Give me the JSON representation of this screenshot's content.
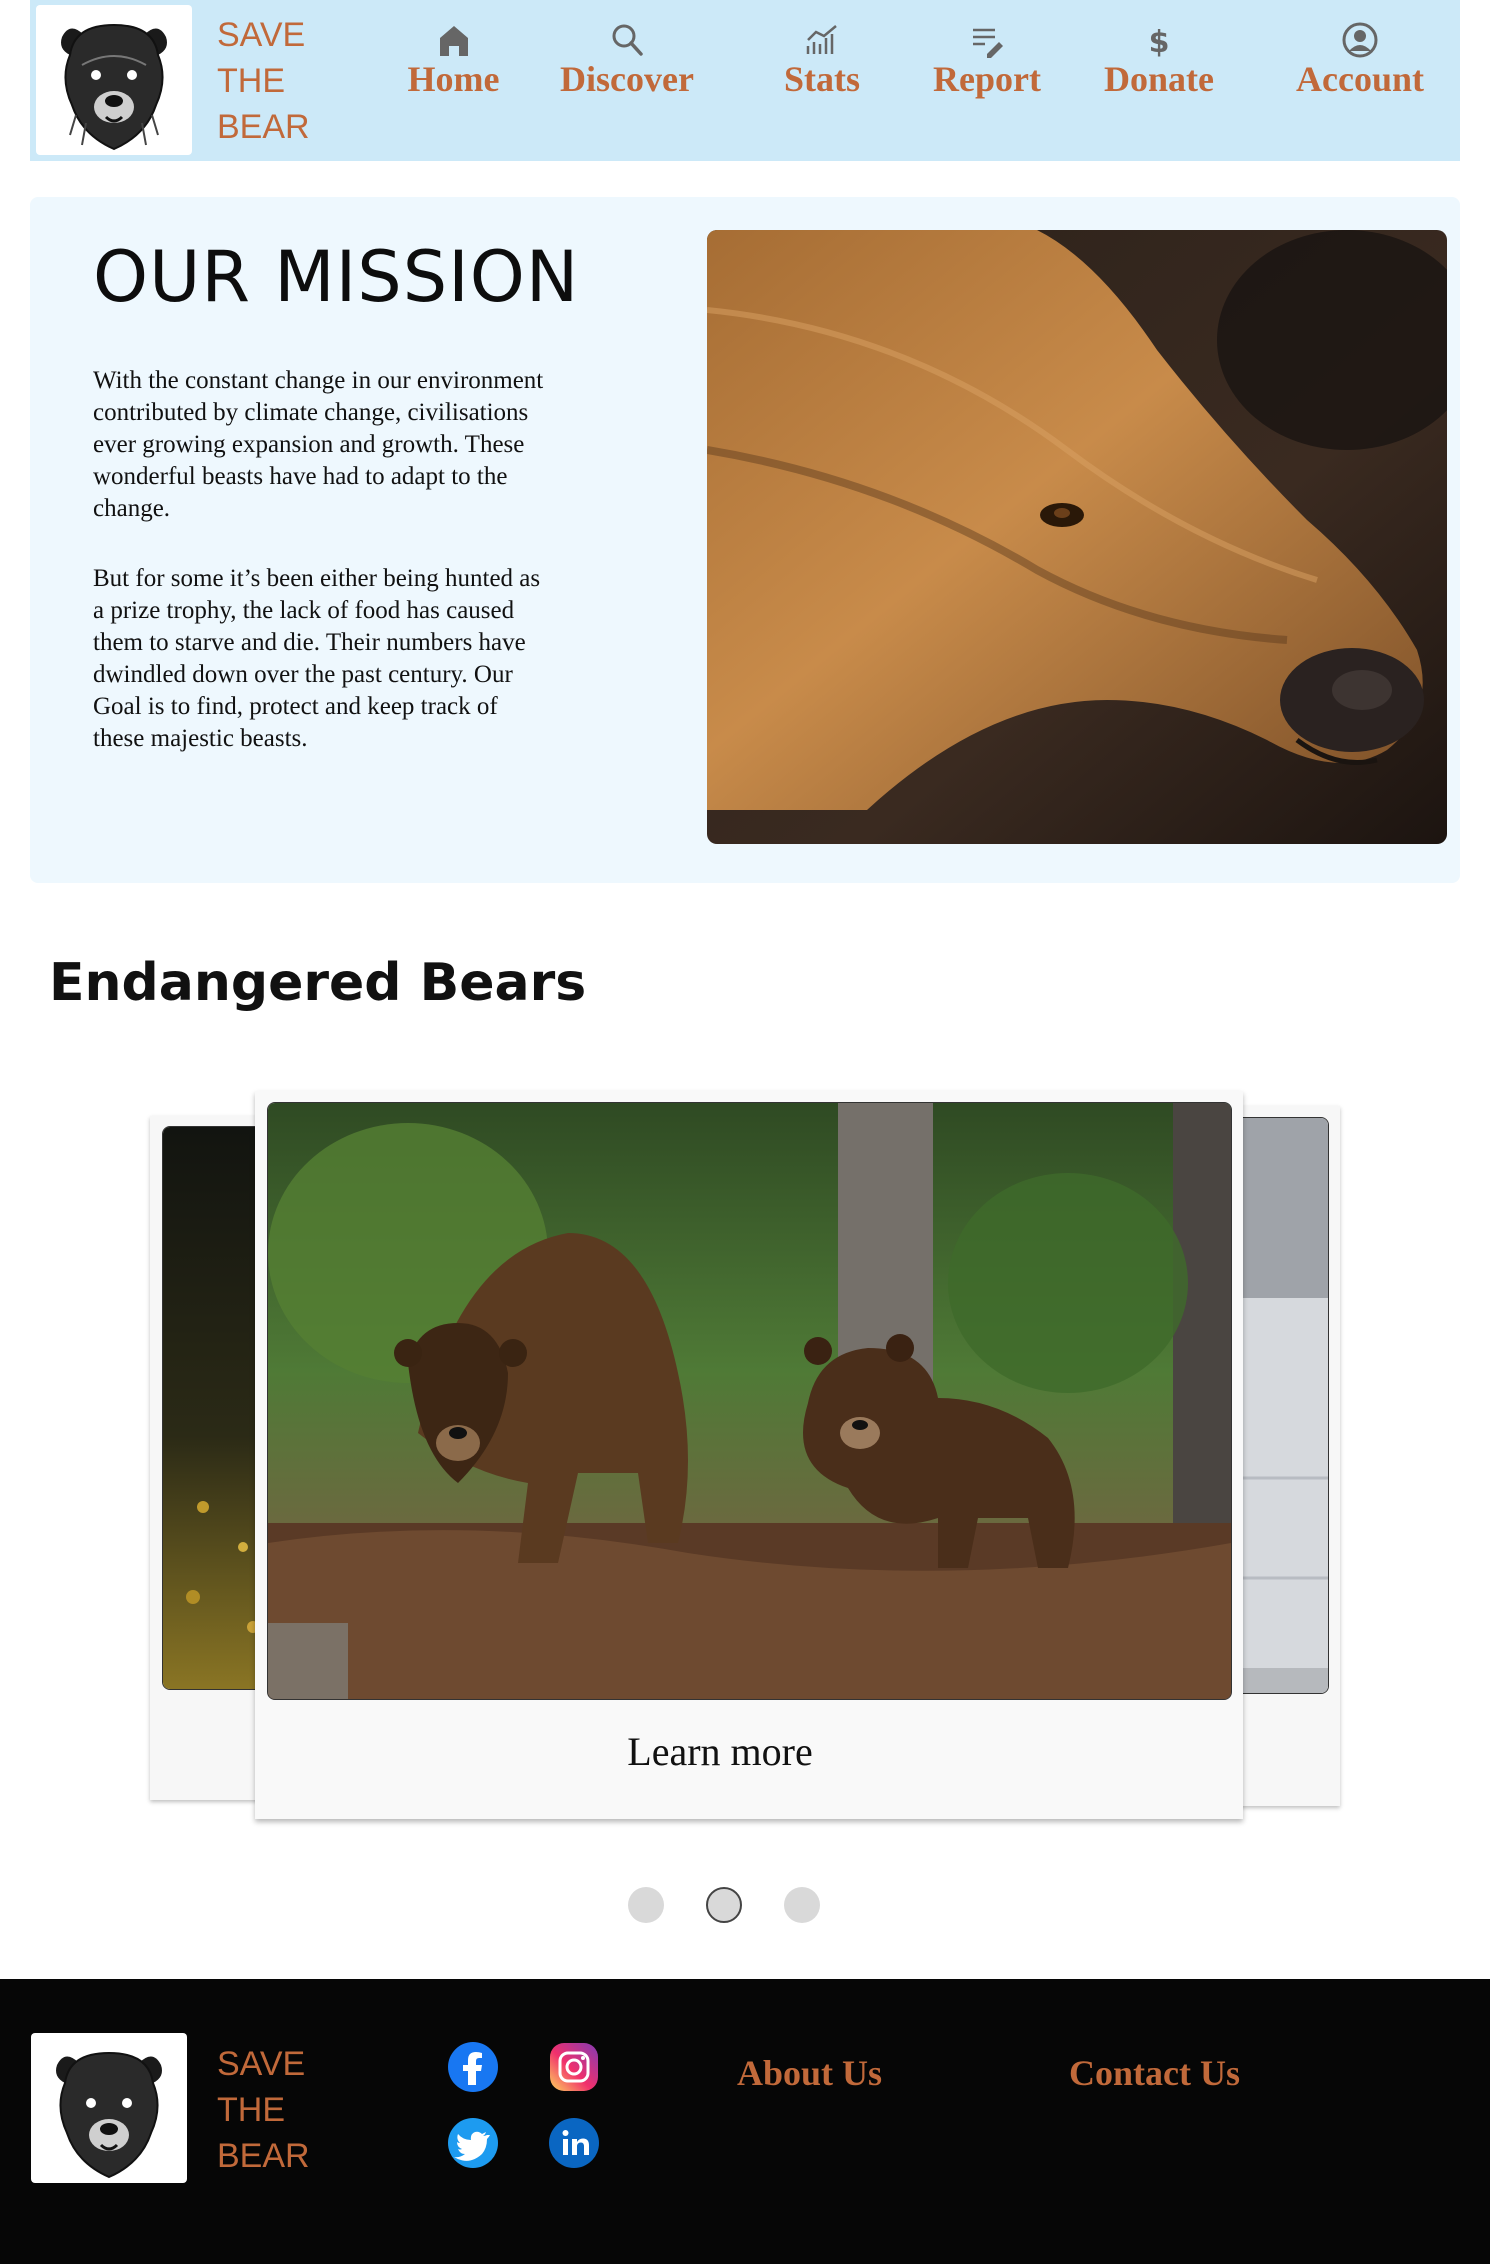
{
  "brand": {
    "name_lines": [
      "SAVE",
      "THE",
      "BEAR"
    ],
    "accent_color": "#c1693a",
    "header_bg": "#cce9f8"
  },
  "nav": [
    {
      "label": "Home",
      "icon": "home-icon"
    },
    {
      "label": "Discover",
      "icon": "search-icon"
    },
    {
      "label": "Stats",
      "icon": "chart-icon"
    },
    {
      "label": "Report",
      "icon": "edit-list-icon"
    },
    {
      "label": "Donate",
      "icon": "dollar-icon"
    },
    {
      "label": "Account",
      "icon": "user-circle-icon"
    }
  ],
  "mission": {
    "title": "OUR MISSION",
    "paragraph_1_lines": [
      "With the constant change in our environment",
      "contributed by climate change, civilisations",
      "ever growing expansion and growth. These",
      "wonderful beasts have had to adapt to the",
      "change."
    ],
    "paragraph_2_lines": [
      "But for some it’s been either being hunted as",
      "a prize trophy, the lack of food has caused",
      "them to starve and die. Their numbers have",
      "dwindled down over the past century. Our",
      "Goal is to find, protect and keep track of",
      "these majestic beasts."
    ]
  },
  "endangered": {
    "title": "Endangered Bears",
    "card_button": "Learn more",
    "carousel_active_index": 1,
    "carousel_count": 3
  },
  "footer": {
    "socials": [
      "facebook-icon",
      "instagram-icon",
      "twitter-icon",
      "linkedin-icon"
    ],
    "links": [
      "About Us",
      "Contact Us"
    ]
  }
}
